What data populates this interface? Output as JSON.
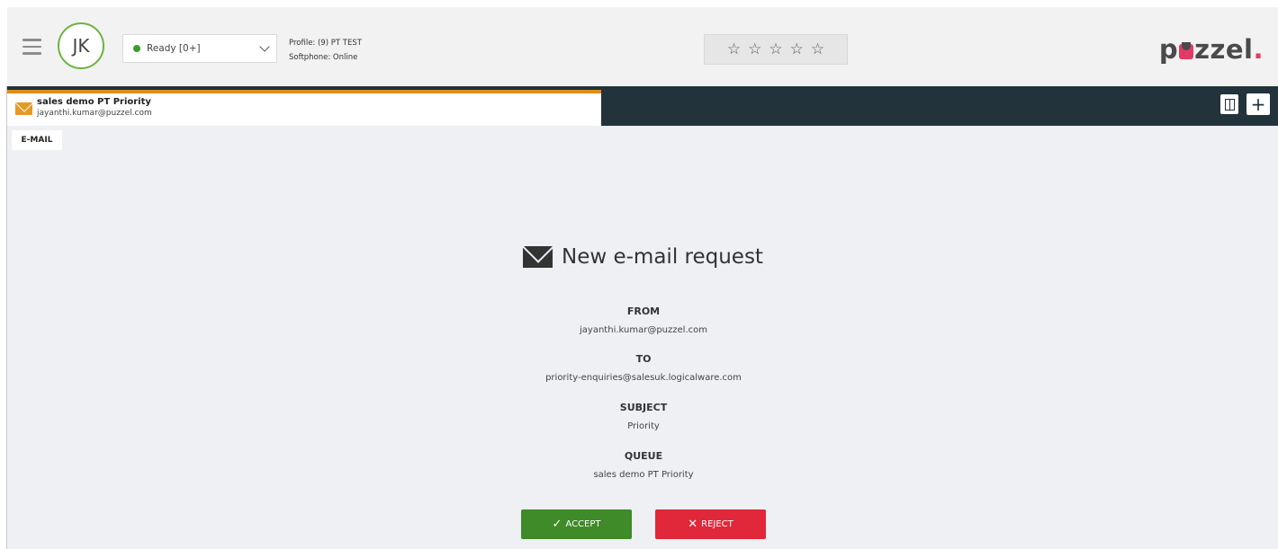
{
  "header": {
    "avatar_initials": "JK",
    "status": "Ready [0+]",
    "profile": "Profile: (9) PT TEST",
    "softphone": "Softphone: Online",
    "stars": [
      "☆",
      "☆",
      "☆",
      "☆",
      "☆"
    ],
    "logo_pre": "p",
    "logo_post": "zzel",
    "logo_dot": "."
  },
  "tab": {
    "title": "sales demo PT Priority",
    "subtitle": "jayanthi.kumar@puzzel.com"
  },
  "channel_label": "E-MAIL",
  "request": {
    "title": "New e-mail request",
    "fields": [
      {
        "label": "FROM",
        "value": "jayanthi.kumar@puzzel.com"
      },
      {
        "label": "TO",
        "value": "priority-enquiries@salesuk.logicalware.com"
      },
      {
        "label": "SUBJECT",
        "value": "Priority"
      },
      {
        "label": "QUEUE",
        "value": "sales demo PT Priority"
      }
    ]
  },
  "actions": {
    "accept_label": "ACCEPT",
    "reject_label": "REJECT"
  },
  "colors": {
    "accent_orange": "#e08b1a",
    "dark_strip": "#22333b",
    "accept": "#3f8a29",
    "reject": "#e0283a",
    "brand_pink": "#e23b63"
  }
}
